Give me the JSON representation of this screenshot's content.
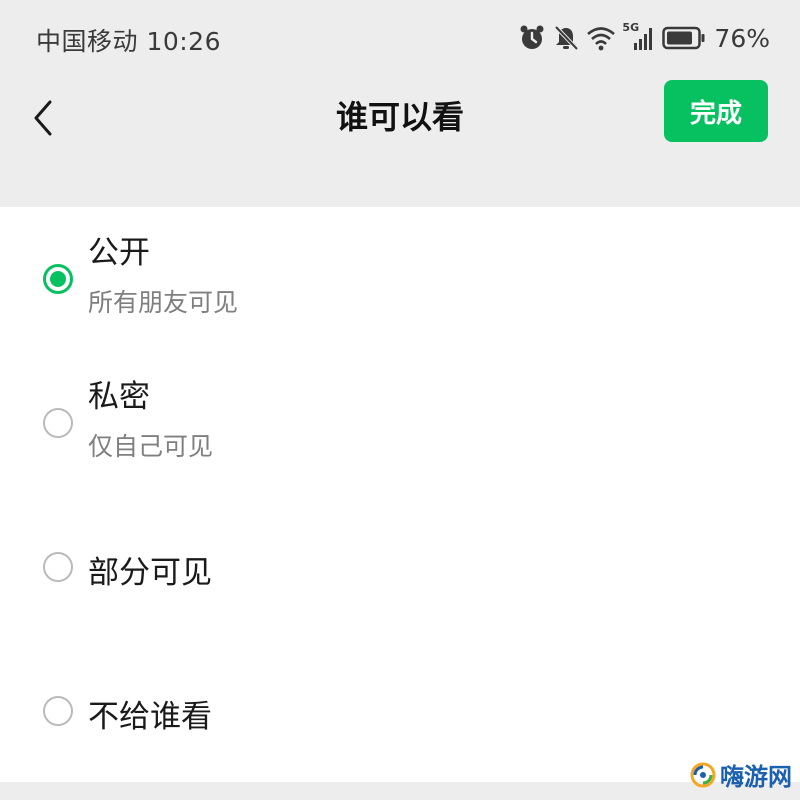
{
  "status_bar": {
    "carrier_time": "中国移动 10:26",
    "network": "5G",
    "battery": "76%",
    "icons": [
      "alarm-icon",
      "mute-icon",
      "wifi-icon",
      "signal-icon",
      "battery-icon"
    ]
  },
  "nav": {
    "back_icon": "chevron-left-icon",
    "title": "谁可以看",
    "done_label": "完成"
  },
  "options": [
    {
      "title": "公开",
      "subtitle": "所有朋友可见",
      "selected": true
    },
    {
      "title": "私密",
      "subtitle": "仅自己可见",
      "selected": false
    },
    {
      "title": "部分可见",
      "subtitle": "",
      "selected": false
    },
    {
      "title": "不给谁看",
      "subtitle": "",
      "selected": false
    }
  ],
  "watermark": {
    "text": "嗨游网"
  },
  "colors": {
    "accent": "#07c160",
    "background": "#ededed",
    "card": "#ffffff",
    "subtitle": "#7f7f7f"
  }
}
